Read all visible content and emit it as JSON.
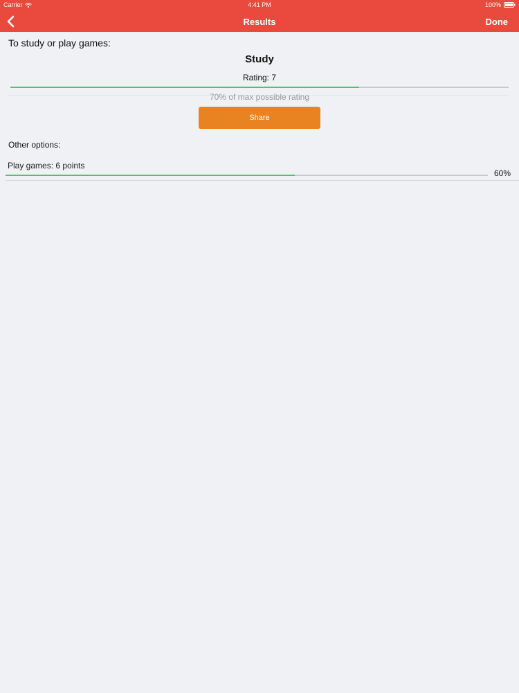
{
  "status_bar": {
    "carrier": "Carrier",
    "time": "4:41 PM",
    "battery": "100%"
  },
  "nav_bar": {
    "title": "Results",
    "done_label": "Done",
    "back_icon": "chevron-left-icon"
  },
  "results": {
    "question": "To study or play games:",
    "winner": {
      "name": "Study",
      "rating_text": "Rating: 7",
      "percent_text": "70% of max possible rating",
      "percent": 70
    },
    "share_label": "Share",
    "other_label": "Other options:",
    "options": [
      {
        "label": "Play games: 6 points",
        "percent_text": "60%",
        "percent": 60
      }
    ]
  },
  "colors": {
    "accent": "#ea4a3d",
    "share": "#e98322",
    "progress": "#4cc567"
  }
}
